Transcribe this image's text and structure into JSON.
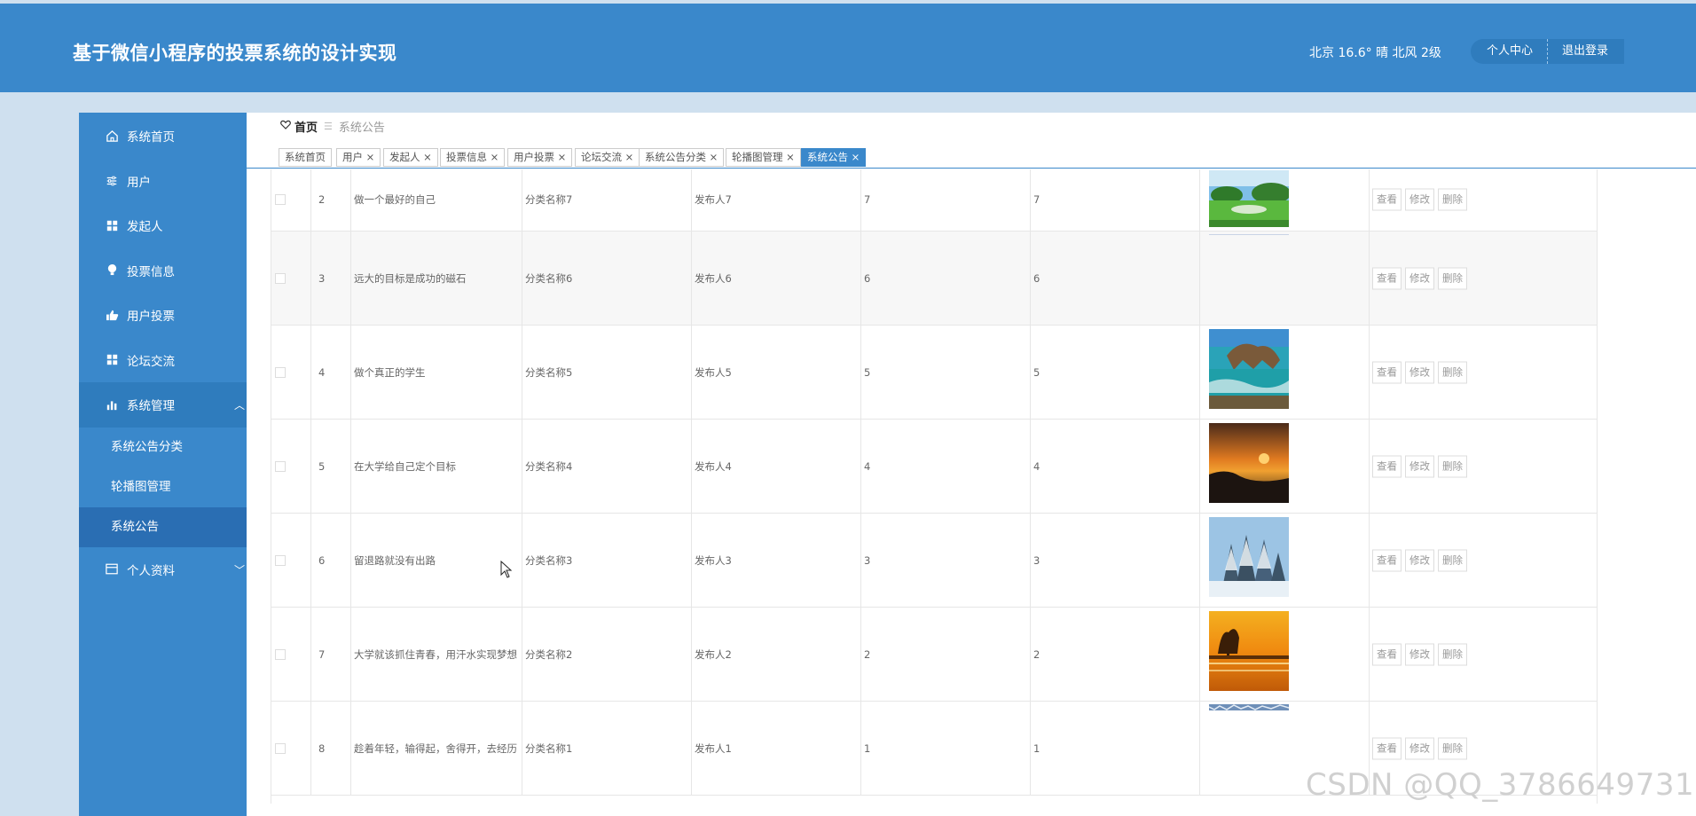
{
  "header": {
    "title": "基于微信小程序的投票系统的设计实现",
    "weather": "北京  16.6°  晴  北风  2级",
    "user_center": "个人中心",
    "logout": "退出登录"
  },
  "sidebar": {
    "items": [
      {
        "label": "系统首页",
        "icon": "home-icon"
      },
      {
        "label": "用户",
        "icon": "sliders-icon"
      },
      {
        "label": "发起人",
        "icon": "grid-icon"
      },
      {
        "label": "投票信息",
        "icon": "bulb-icon"
      },
      {
        "label": "用户投票",
        "icon": "vote-icon"
      },
      {
        "label": "论坛交流",
        "icon": "grid-icon"
      },
      {
        "label": "系统管理",
        "icon": "bar-chart-icon",
        "expanded": true
      },
      {
        "label": "个人资料",
        "icon": "card-icon"
      }
    ],
    "sub_items": [
      "系统公告分类",
      "轮播图管理",
      "系统公告"
    ]
  },
  "breadcrumb": {
    "home": "首页",
    "current": "系统公告"
  },
  "tabs": [
    {
      "label": "系统首页"
    },
    {
      "label": "用户 ×"
    },
    {
      "label": "发起人 ×"
    },
    {
      "label": "投票信息 ×"
    },
    {
      "label": "用户投票 ×"
    },
    {
      "label": "论坛交流 ×"
    },
    {
      "label": "系统公告分类 ×"
    },
    {
      "label": "轮播图管理 ×"
    },
    {
      "label": "系统公告 ×",
      "active": true
    }
  ],
  "table": {
    "actions": {
      "view": "查看",
      "edit": "修改",
      "delete": "删除"
    },
    "rows": [
      {
        "idx": "2",
        "title": "做一个最好的自己",
        "category": "分类名称7",
        "publisher": "发布人7",
        "a": "7",
        "b": "7",
        "image": "meadow-landscape"
      },
      {
        "idx": "3",
        "title": "远大的目标是成功的磁石",
        "category": "分类名称6",
        "publisher": "发布人6",
        "a": "6",
        "b": "6",
        "image": "none"
      },
      {
        "idx": "4",
        "title": "做个真正的学生",
        "category": "分类名称5",
        "publisher": "发布人5",
        "a": "5",
        "b": "5",
        "image": "sea-rocks"
      },
      {
        "idx": "5",
        "title": "在大学给自己定个目标",
        "category": "分类名称4",
        "publisher": "发布人4",
        "a": "4",
        "b": "4",
        "image": "sunset-sea"
      },
      {
        "idx": "6",
        "title": "留退路就没有出路",
        "category": "分类名称3",
        "publisher": "发布人3",
        "a": "3",
        "b": "3",
        "image": "snow-forest"
      },
      {
        "idx": "7",
        "title": "大学就该抓住青春，用汗水实现梦想",
        "category": "分类名称2",
        "publisher": "发布人2",
        "a": "2",
        "b": "2",
        "image": "sunset-lake"
      },
      {
        "idx": "8",
        "title": "趁着年轻，输得起，舍得开，去经历",
        "category": "分类名称1",
        "publisher": "发布人1",
        "a": "1",
        "b": "1",
        "image": "winter-strip"
      }
    ]
  },
  "watermark": "CSDN @QQ_3786649731",
  "colors": {
    "primary": "#3a88cb",
    "header": "#3a88cb",
    "page_bg": "#cfe0ef"
  }
}
